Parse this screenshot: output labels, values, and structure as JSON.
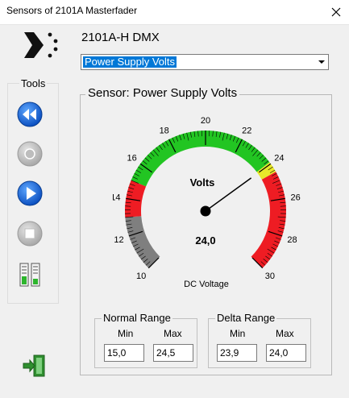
{
  "window": {
    "title": "Sensors of 2101A Masterfader"
  },
  "device": {
    "name": "2101A-H DMX"
  },
  "sensor_select": {
    "value": "Power Supply Volts"
  },
  "tools": {
    "label": "Tools",
    "items": [
      {
        "icon": "rewind-icon"
      },
      {
        "icon": "record-icon-disabled"
      },
      {
        "icon": "play-icon"
      },
      {
        "icon": "stop-icon-disabled"
      },
      {
        "icon": "level-meter-icon"
      }
    ]
  },
  "sensor_panel": {
    "title": "Sensor: Power Supply Volts",
    "gauge": {
      "unit_label": "Volts",
      "value_text": "24,0",
      "caption": "DC Voltage",
      "min": 10,
      "max": 30,
      "value": 24.0,
      "tick_labels": [
        "10",
        "12",
        "14",
        "16",
        "18",
        "20",
        "22",
        "24",
        "26",
        "28",
        "30"
      ],
      "zones": [
        {
          "from": 10,
          "to": 13,
          "color": "#7f7f7f"
        },
        {
          "from": 13,
          "to": 15,
          "color": "#ee1c23"
        },
        {
          "from": 15,
          "to": 23.9,
          "color": "#22c522"
        },
        {
          "from": 23.9,
          "to": 24.5,
          "color": "#e8e82a"
        },
        {
          "from": 24.5,
          "to": 30,
          "color": "#ee1c23"
        }
      ]
    },
    "normal_range": {
      "label": "Normal Range",
      "min_label": "Min",
      "max_label": "Max",
      "min": "15,0",
      "max": "24,5"
    },
    "delta_range": {
      "label": "Delta Range",
      "min_label": "Min",
      "max_label": "Max",
      "min": "23,9",
      "max": "24,0"
    }
  },
  "footer": {
    "icon": "exit-door-icon"
  }
}
